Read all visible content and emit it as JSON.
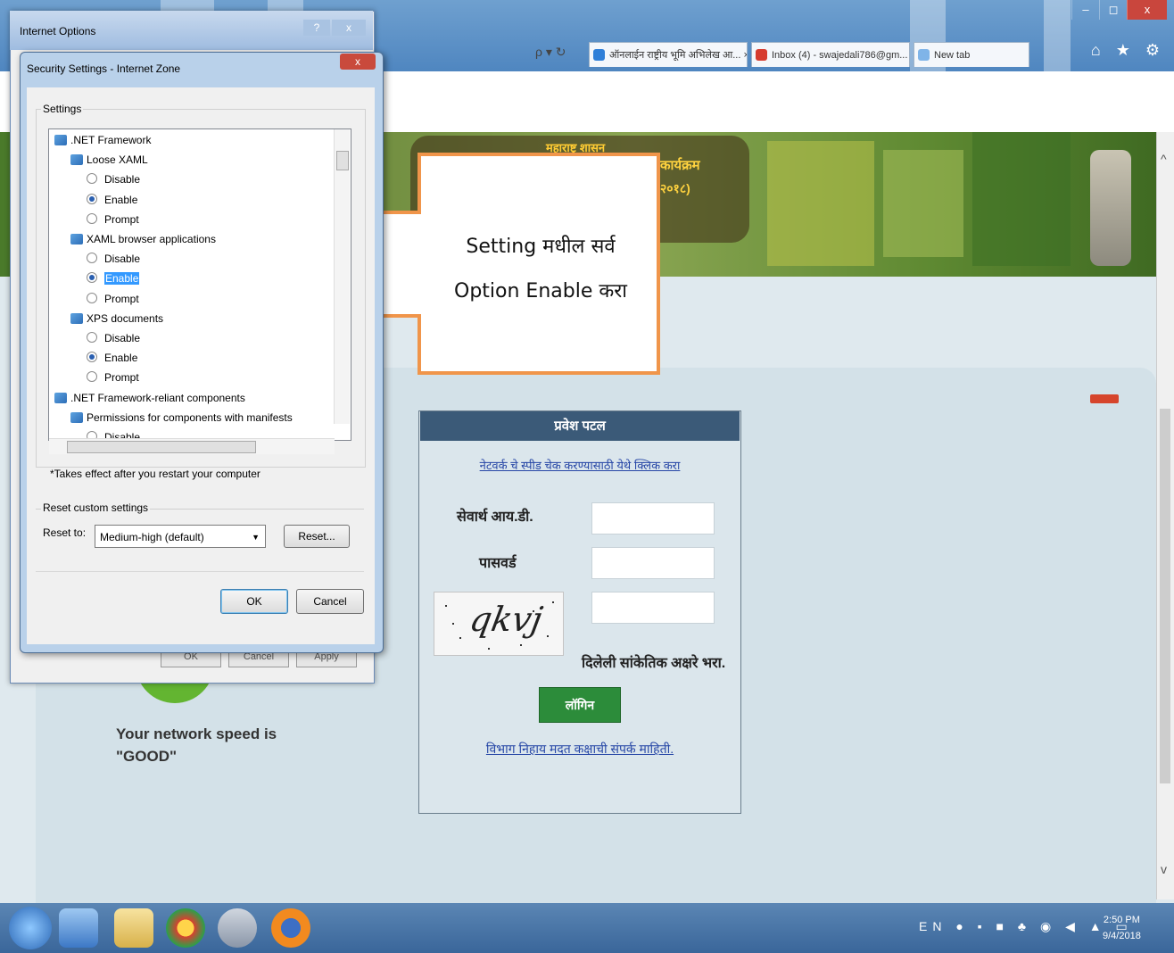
{
  "browser": {
    "tabs": [
      {
        "label": "ऑनलाईन राष्ट्रीय भूमि अभिलेख आ... ×"
      },
      {
        "label": "Inbox (4) - swajedali786@gm..."
      },
      {
        "label": "New tab"
      }
    ],
    "address_controls": "ρ ▾ ↻",
    "window_buttons": {
      "minimize": "–",
      "restore": "◻",
      "close": "x"
    },
    "tool_icons": "⌂ ★ ⚙"
  },
  "banner": {
    "line1": "महाराष्ट्र शासन",
    "line2": "कार्यक्रम",
    "line3": "२०१८)"
  },
  "callout": {
    "text_line1": "Setting मधील सर्व",
    "text_line2": "Option Enable करा"
  },
  "page": {
    "speed_line1": "Your network speed is",
    "speed_line2": "\"GOOD\""
  },
  "login": {
    "header": "प्रवेश पटल",
    "speed_link": "नेटवर्क चे स्पीड चेक करण्यासाठी येथे क्लिक करा",
    "user_label": "सेवार्थ आय.डी.",
    "password_label": "पासवर्ड",
    "captcha_text": "qkvj",
    "captcha_instruction": "दिलेली सांकेतिक अक्षरे भरा.",
    "login_button": "लॉगिन",
    "contact_link": "विभाग निहाय मदत कक्षाची संपर्क माहिती."
  },
  "internet_options": {
    "title": "Internet Options",
    "help": "?",
    "close": "x",
    "buttons": [
      "OK",
      "Cancel",
      "Apply"
    ]
  },
  "security_dialog": {
    "title": "Security Settings - Internet Zone",
    "close": "x",
    "settings_group": "Settings",
    "tree": [
      {
        "label": ".NET Framework",
        "kind": "category",
        "indent": 0
      },
      {
        "label": "Loose XAML",
        "kind": "subcategory",
        "indent": 1
      },
      {
        "label": "Disable",
        "kind": "radio",
        "indent": 2,
        "checked": false
      },
      {
        "label": "Enable",
        "kind": "radio",
        "indent": 2,
        "checked": true
      },
      {
        "label": "Prompt",
        "kind": "radio",
        "indent": 2,
        "checked": false
      },
      {
        "label": "XAML browser applications",
        "kind": "subcategory",
        "indent": 1
      },
      {
        "label": "Disable",
        "kind": "radio",
        "indent": 2,
        "checked": false
      },
      {
        "label": "Enable",
        "kind": "radio",
        "indent": 2,
        "checked": true,
        "selected": true
      },
      {
        "label": "Prompt",
        "kind": "radio",
        "indent": 2,
        "checked": false
      },
      {
        "label": "XPS documents",
        "kind": "subcategory",
        "indent": 1
      },
      {
        "label": "Disable",
        "kind": "radio",
        "indent": 2,
        "checked": false
      },
      {
        "label": "Enable",
        "kind": "radio",
        "indent": 2,
        "checked": true
      },
      {
        "label": "Prompt",
        "kind": "radio",
        "indent": 2,
        "checked": false
      },
      {
        "label": ".NET Framework-reliant components",
        "kind": "category",
        "indent": 0
      },
      {
        "label": "Permissions for components with manifests",
        "kind": "subcategory",
        "indent": 1
      },
      {
        "label": "Disable",
        "kind": "radio",
        "indent": 2,
        "checked": false
      }
    ],
    "restart_note": "*Takes effect after you restart your computer",
    "reset_group": "Reset custom settings",
    "reset_to_label": "Reset to:",
    "reset_to_value": "Medium-high (default)",
    "reset_button": "Reset...",
    "ok_button": "OK",
    "cancel_button": "Cancel"
  },
  "taskbar": {
    "clock_time": "2:50 PM",
    "clock_date": "9/4/2018",
    "tray_lang": "EN"
  }
}
